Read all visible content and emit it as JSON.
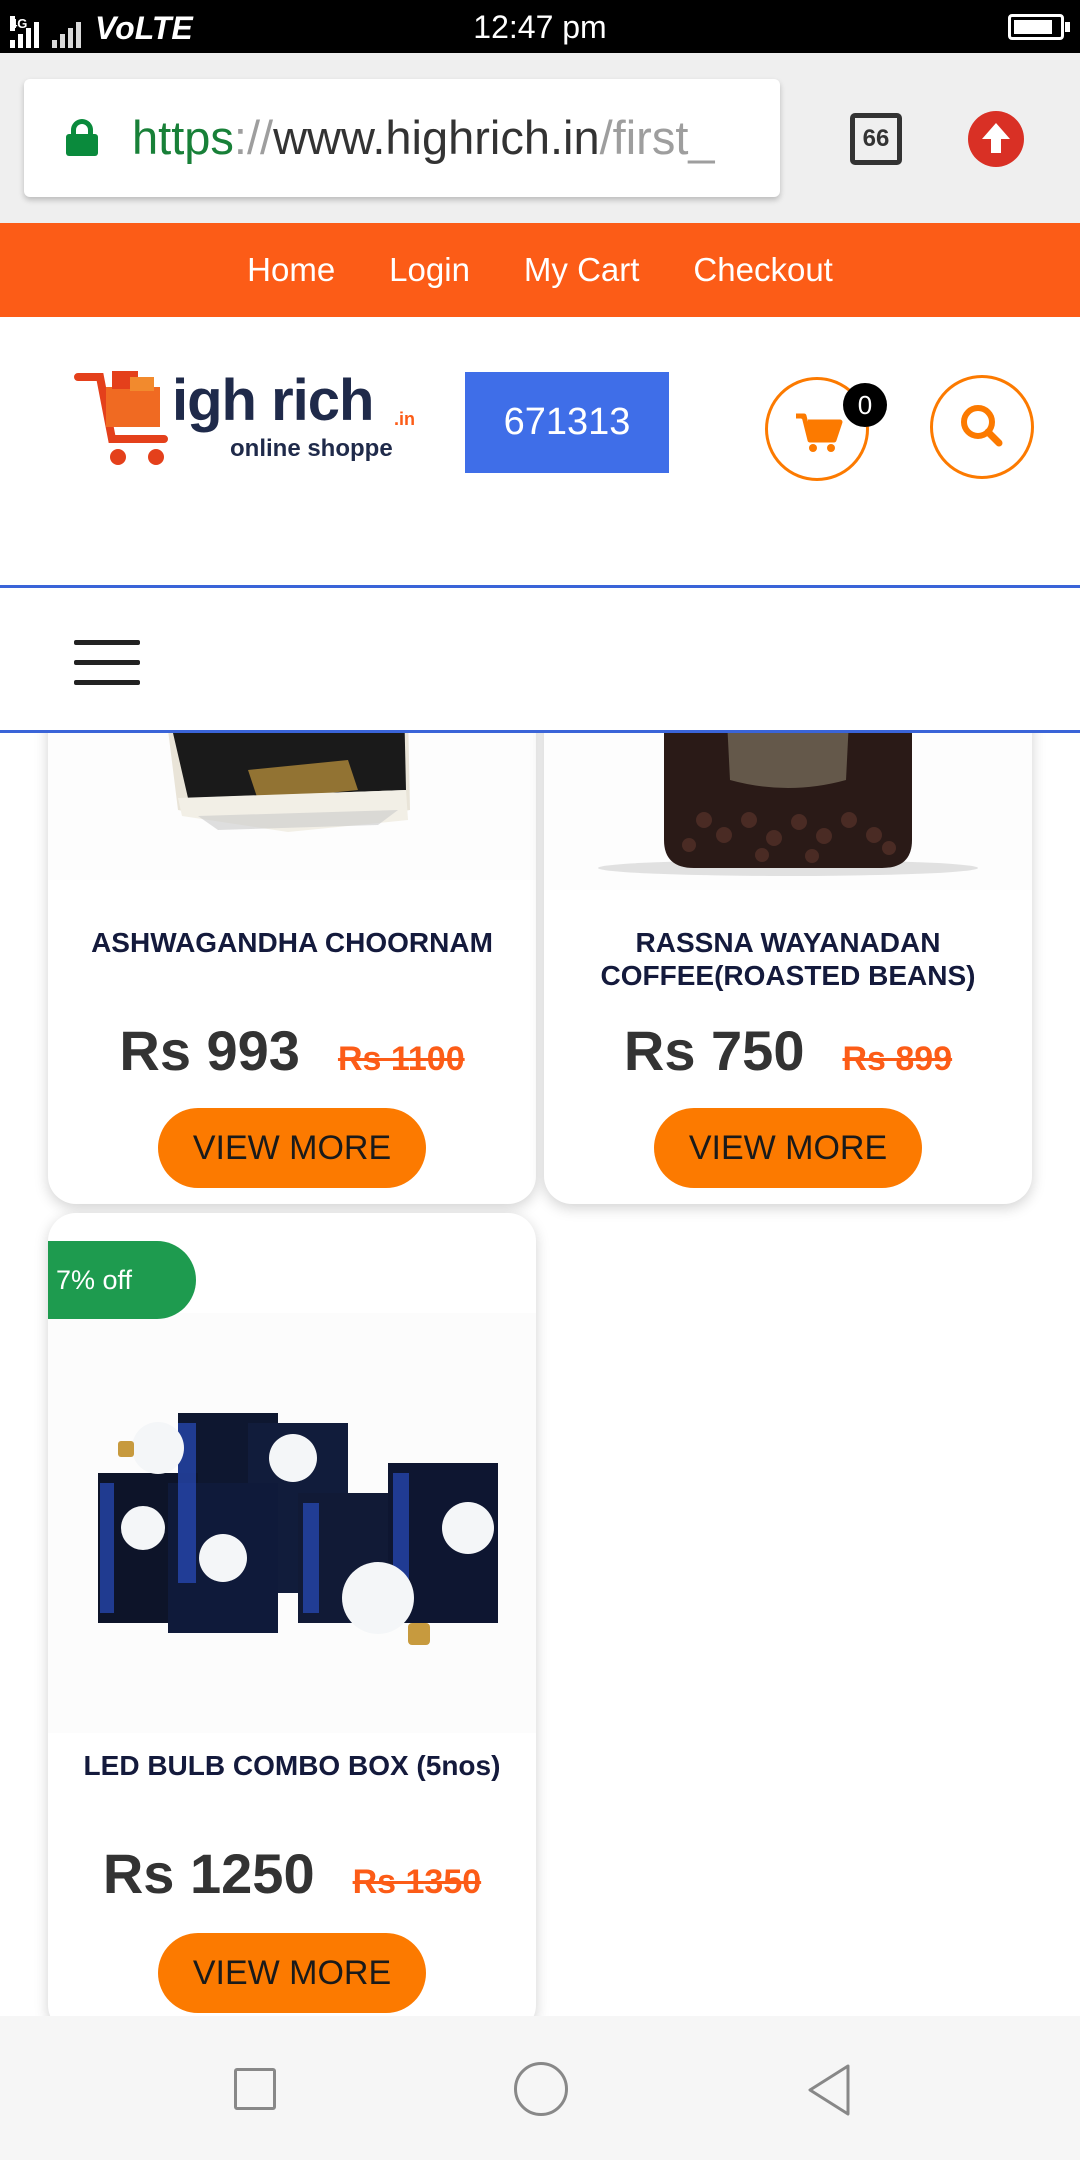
{
  "status_bar": {
    "network": "4G",
    "carrier_label": "VoLTE",
    "time": "12:47 pm",
    "icons": [
      "signal-icon",
      "no-signal-icon",
      "battery-icon"
    ]
  },
  "browser": {
    "url_scheme": "https",
    "url_separator": "://",
    "url_host": "www.highrich.in",
    "url_path": "/first_",
    "tab_count": "66",
    "icons": [
      "lock-icon",
      "tabs-icon",
      "update-icon"
    ]
  },
  "top_nav": {
    "items": [
      "Home",
      "Login",
      "My Cart",
      "Checkout"
    ]
  },
  "header": {
    "logo_main": "igh rich",
    "logo_suffix": ".in",
    "logo_sub": "online shoppe",
    "phone": "671313",
    "cart_count": "0",
    "icons": [
      "logo-cart-icon",
      "cart-icon",
      "search-icon",
      "hamburger-icon"
    ]
  },
  "products": [
    {
      "name": "ASHWAGANDHA CHOORNAM",
      "price": "Rs 993",
      "old_price": "Rs 1100",
      "button": "VIEW MORE"
    },
    {
      "name": "RASSNA WAYANADAN COFFEE(ROASTED BEANS)",
      "price": "Rs 750",
      "old_price": "Rs 899",
      "button": "VIEW MORE"
    },
    {
      "badge": "7% off",
      "name": "LED BULB COMBO BOX (5nos)",
      "price": "Rs 1250",
      "old_price": "Rs 1350",
      "button": "VIEW MORE"
    }
  ],
  "colors": {
    "nav_orange": "#fc5c17",
    "button_orange": "#fc7a00",
    "phone_blue": "#3f6ee8",
    "badge_green": "#1e9b4f",
    "name_navy": "#141a3c"
  },
  "android_nav": {
    "icons": [
      "recent-apps-icon",
      "home-icon",
      "back-icon"
    ]
  }
}
